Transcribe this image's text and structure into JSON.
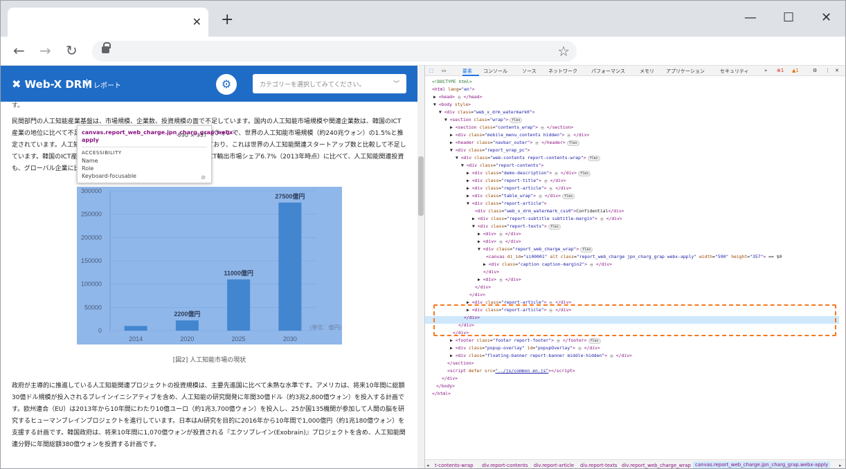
{
  "browser": {
    "tab_close": "✕",
    "new_tab": "+",
    "minimize": "—",
    "maximize": "☐",
    "close": "✕",
    "back": "←",
    "forward": "→",
    "reload": "↻",
    "bookmark": "☆"
  },
  "site": {
    "logo": "Web-X DRM",
    "logo_sub": "レポート",
    "category_placeholder": "カテゴリーを選択してみてください。"
  },
  "article": {
    "para_top": "す。",
    "para1": "民間部門の人工知能産業基盤は、市場規模、企業数、投資規模の面で不足しています。国内の人工知能市場規模や関連企業数は、韓国のICT産業の地位に比べて不足しています。国内の人工知能市場規模は、3.6兆ウォンで、世界の人工知能市場規模（約240兆ウォン）の1.5%と推定されています。人工知能関連企業数は、約24社から64社と推定されており、これは世界の人工知能関連スタートアップ数と比較して不足しています。韓国のICT産業の世界ICT産業比率10.7%（2015年時点）、ICT輸出市場シェア6.7%（2013年時点）に比べて、人工知能関連投資も、グローバル企業に比べて低い水準です。",
    "caption": "[図2] 人工知能市場の現状",
    "para2": "政府が主導的に推進している人工知能関連プロジェクトの投資規模は、主要先進国に比べて未熟な水準です。アメリカは、将来10年間に総額30億ドル規模が投入されるブレインイニシアティブを含め、人工知能の研究開発に年間30億ドル（約3兆2,800億ウォン）を投入する計画です。欧州連合（EU）は2013年から10年間にわたり10億ユーロ（約1兆3,700億ウォン）を投入し、25か国135機関が参加して人間の脳を研究するヒューマンブレインプロジェクトを進行しています。日本はAI研究を目的に2016年から10年間で1,000億円（約1兆180億ウォン）を支援する計画です。韓国政府は、将来10年間に1,070億ウォンが投資される『エクソブレイン(Exobrain)』プロジェクトを含め、人工知能関連分野に年間総額380億ウォンを投資する計画です。"
  },
  "tooltip": {
    "title": "canvas.report_web_charge.jpn_charg_grap.webx-apply",
    "size": "590 × 357",
    "section": "ACCESSIBILITY",
    "rows": [
      "Name",
      "Role",
      "Keyboard-focusable"
    ]
  },
  "chart_data": {
    "type": "bar",
    "categories": [
      "2014",
      "2020",
      "2025",
      "2030"
    ],
    "values": [
      10000,
      22000,
      110000,
      275000
    ],
    "data_labels": [
      "",
      "2200億円",
      "11000億円",
      "27500億円"
    ],
    "y_ticks": [
      "0",
      "50000",
      "100000",
      "150000",
      "200000",
      "250000",
      "300000"
    ],
    "ylim": [
      0,
      300000
    ],
    "unit_note": "(単位：億円)",
    "bar_color": "#4286cf",
    "bg_color": "#8fb7ea"
  },
  "devtools": {
    "tabs": [
      "要素",
      "コンソール",
      "ソース",
      "ネットワーク",
      "パフォーマンス",
      "メモリ",
      "アプリケーション",
      "セキュリティ"
    ],
    "errors": "1",
    "warnings": "1",
    "breadcrumbs": [
      "t-contents-wrap",
      "div.report-contents",
      "div.report-article",
      "div.report-texts",
      "div.report_web_charge_wrap",
      "canvas.report_web_charge.jpn_charg_grap.webx-apply"
    ]
  }
}
